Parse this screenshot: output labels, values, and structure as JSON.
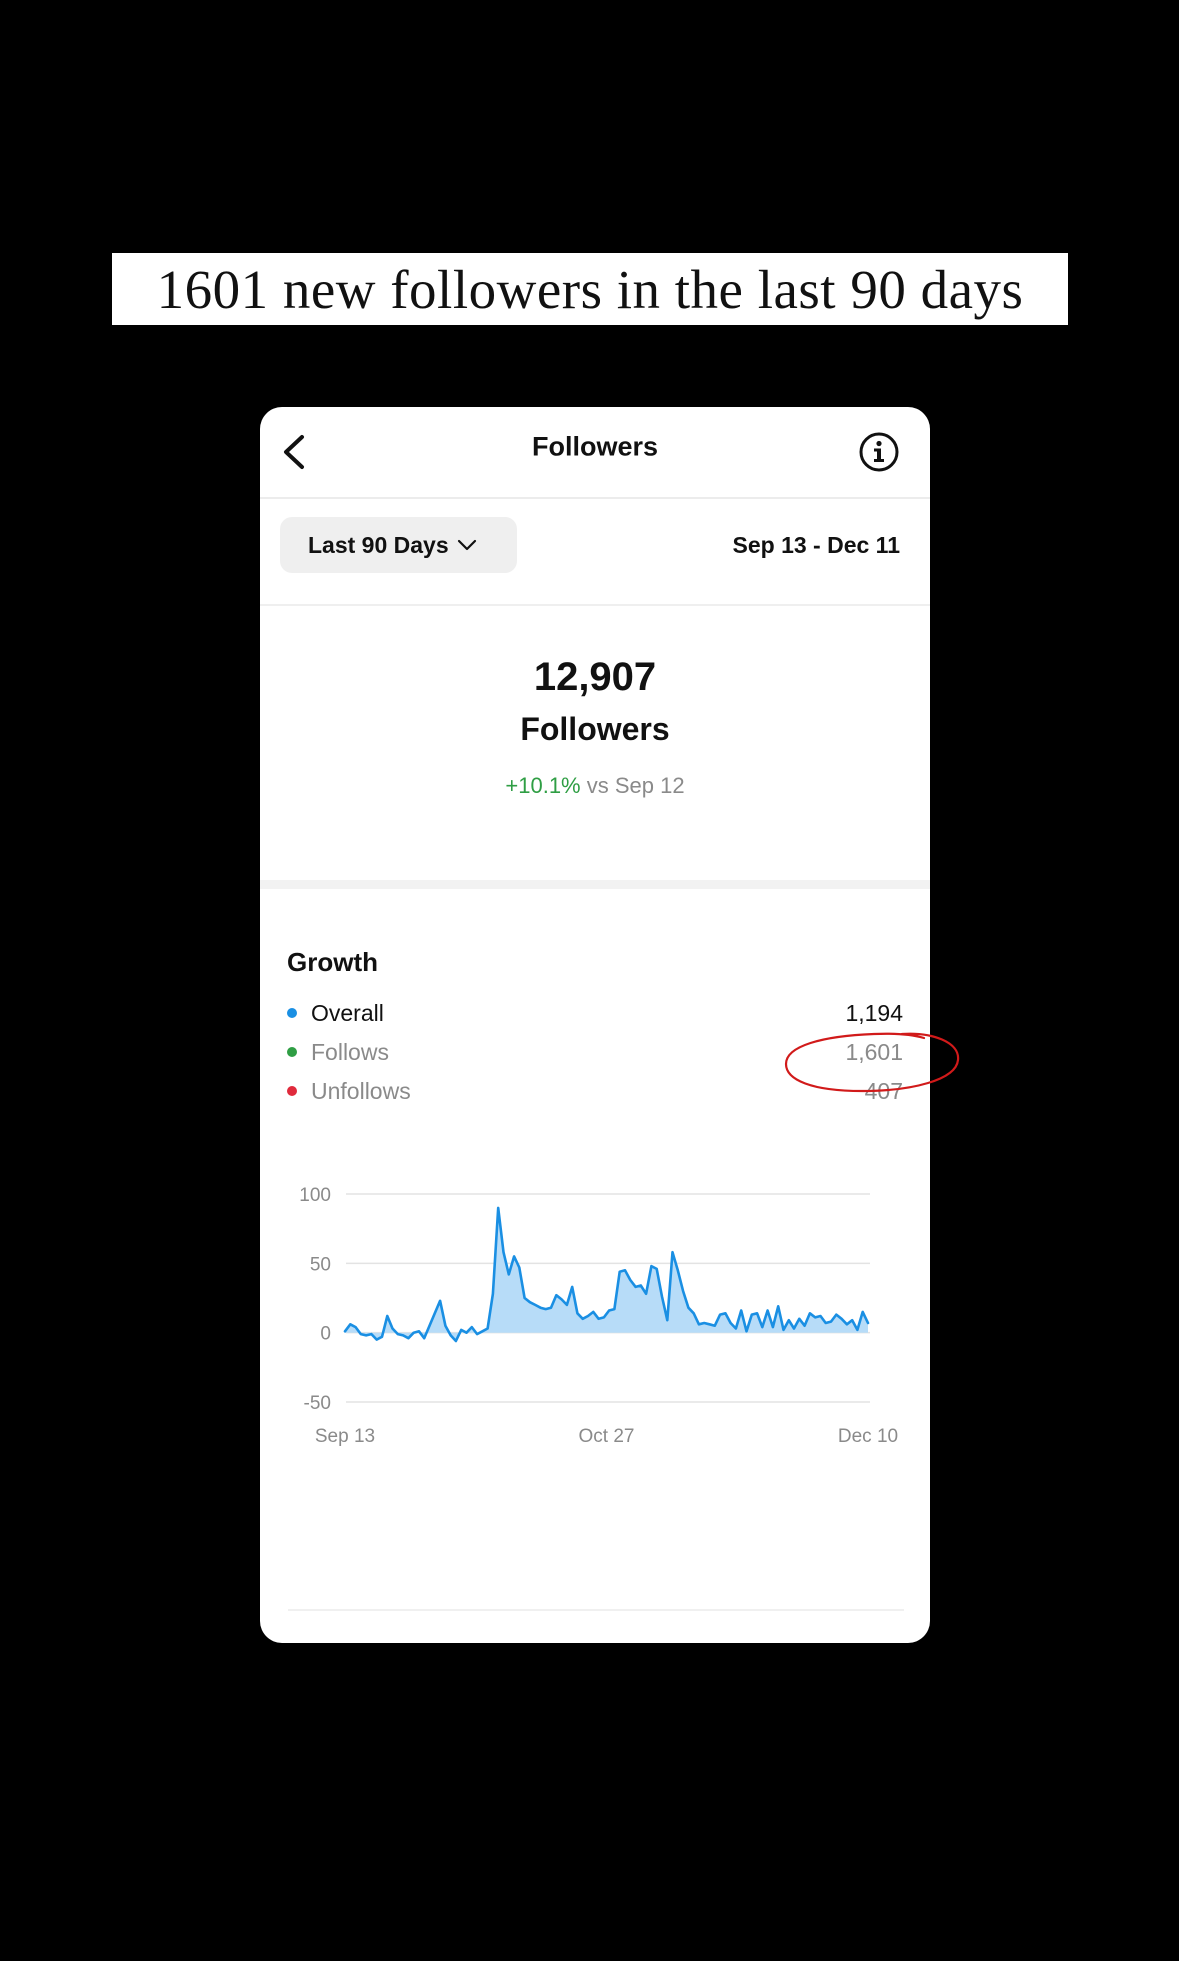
{
  "caption": "1601 new followers in the last 90 days",
  "header": {
    "title": "Followers"
  },
  "filter": {
    "range_label": "Last 90 Days",
    "date_range": "Sep 13 - Dec 11"
  },
  "summary": {
    "count": "12,907",
    "label": "Followers",
    "change_pct": "+10.1%",
    "change_suffix": "vs Sep 12"
  },
  "growth": {
    "title": "Growth",
    "rows": [
      {
        "label": "Overall",
        "value": "1,194",
        "color": "#1a8fe3"
      },
      {
        "label": "Follows",
        "value": "1,601",
        "color": "#2f9e44"
      },
      {
        "label": "Unfollows",
        "value": "407",
        "color": "#e02a3c"
      }
    ]
  },
  "annotation_color": "#d11a1a",
  "chart_data": {
    "type": "area",
    "ylim": [
      -50,
      100
    ],
    "yticks": [
      100,
      50,
      0,
      -50
    ],
    "xtick_labels": [
      "Sep 13",
      "Oct 27",
      "Dec 10"
    ],
    "x_range": [
      "Sep 13",
      "Dec 10"
    ],
    "grid": true,
    "line_color": "#1a8fe3",
    "fill_color": "#b7dcf8",
    "series": [
      {
        "values": [
          1,
          6,
          4,
          -1,
          -2,
          -1,
          -5,
          -3,
          12,
          3,
          -1,
          -2,
          -4,
          0,
          1,
          -4,
          5,
          14,
          23,
          5,
          -2,
          -6,
          2,
          0,
          4,
          -1,
          1,
          3,
          28,
          90,
          58,
          42,
          55,
          47,
          25,
          22,
          20,
          18,
          17,
          18,
          27,
          24,
          20,
          33,
          14,
          10,
          12,
          15,
          10,
          11,
          16,
          17,
          44,
          45,
          38,
          33,
          34,
          28,
          48,
          46,
          26,
          9,
          58,
          45,
          30,
          18,
          14,
          6,
          7,
          6,
          5,
          13,
          14,
          7,
          3,
          16,
          1,
          13,
          14,
          4,
          16,
          4,
          19,
          2,
          9,
          3,
          10,
          5,
          14,
          11,
          12,
          7,
          8,
          13,
          10,
          6,
          9,
          2,
          15,
          7
        ]
      }
    ]
  }
}
